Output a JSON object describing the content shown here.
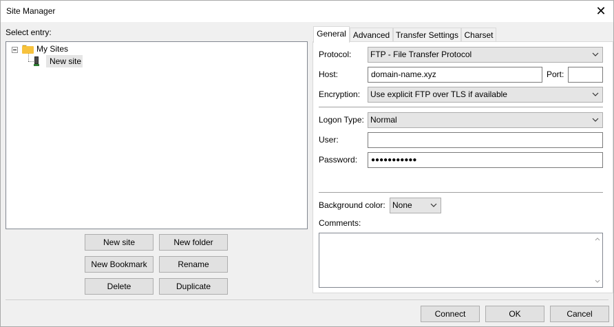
{
  "window": {
    "title": "Site Manager",
    "close_glyph": "✕"
  },
  "left": {
    "select_entry_label": "Select entry:",
    "tree": [
      {
        "label": "My Sites",
        "icon": "folder-icon"
      },
      {
        "label": "New site",
        "icon": "computer-icon",
        "selected": true
      }
    ],
    "buttons": {
      "new_site": "New site",
      "new_folder": "New folder",
      "new_bookmark": "New Bookmark",
      "rename": "Rename",
      "delete": "Delete",
      "duplicate": "Duplicate"
    }
  },
  "tabs": [
    {
      "label": "General",
      "active": true
    },
    {
      "label": "Advanced",
      "active": false
    },
    {
      "label": "Transfer Settings",
      "active": false
    },
    {
      "label": "Charset",
      "active": false
    }
  ],
  "general": {
    "protocol_label": "Protocol:",
    "protocol_value": "FTP - File Transfer Protocol",
    "host_label": "Host:",
    "host_value": "domain-name.xyz",
    "port_label": "Port:",
    "port_value": "",
    "encryption_label": "Encryption:",
    "encryption_value": "Use explicit FTP over TLS if available",
    "logon_type_label": "Logon Type:",
    "logon_type_value": "Normal",
    "user_label": "User:",
    "user_value": "",
    "password_label": "Password:",
    "password_value": "●●●●●●●●●●●",
    "background_color_label": "Background color:",
    "background_color_value": "None",
    "comments_label": "Comments:",
    "comments_value": ""
  },
  "footer": {
    "connect": "Connect",
    "ok": "OK",
    "cancel": "Cancel"
  },
  "colors": {
    "folder": "#f7c23d",
    "button_bg": "#e1e1e1",
    "window_bg": "#f0f0f0"
  }
}
